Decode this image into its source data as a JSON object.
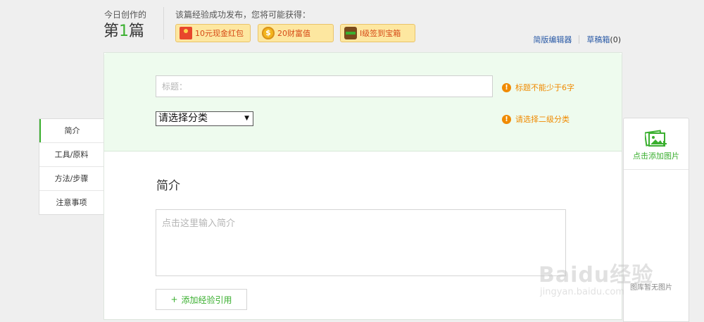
{
  "header": {
    "today_label": "今日创作的",
    "count_prefix": "第",
    "count_number": "1",
    "count_suffix": "篇",
    "reward_intro": "该篇经验成功发布，您将可能获得：",
    "rewards": [
      {
        "label": "10元现金红包",
        "icon": "red-envelope-icon"
      },
      {
        "label": "20财富值",
        "icon": "coin-icon"
      },
      {
        "label": "I级签到宝箱",
        "icon": "treasure-chest-icon"
      }
    ],
    "links": {
      "simple_editor": "简版编辑器",
      "drafts": "草稿箱",
      "drafts_count": "(0)"
    }
  },
  "left_nav": {
    "items": [
      "简介",
      "工具/原料",
      "方法/步骤",
      "注意事项"
    ],
    "active_index": 0
  },
  "form": {
    "title_placeholder": "标题：",
    "title_value": "",
    "title_hint": "标题不能少于6字",
    "category_selected": "请选择分类",
    "category_hint": "请选择二级分类",
    "section_title": "简介",
    "intro_placeholder": "点击这里输入简介",
    "add_ref_label": "添加经验引用",
    "add_ref_plus": "+"
  },
  "right_panel": {
    "add_image_label": "点击添加图片",
    "empty_text": "图库暂无图片"
  },
  "watermark": {
    "main": "Baidu经验",
    "sub": "jingyan.baidu.com"
  },
  "colors": {
    "accent_green": "#3aaf2f",
    "warning_orange": "#f08a00",
    "link_blue": "#2a5aa6",
    "title_area_bg": "#eefbee"
  }
}
